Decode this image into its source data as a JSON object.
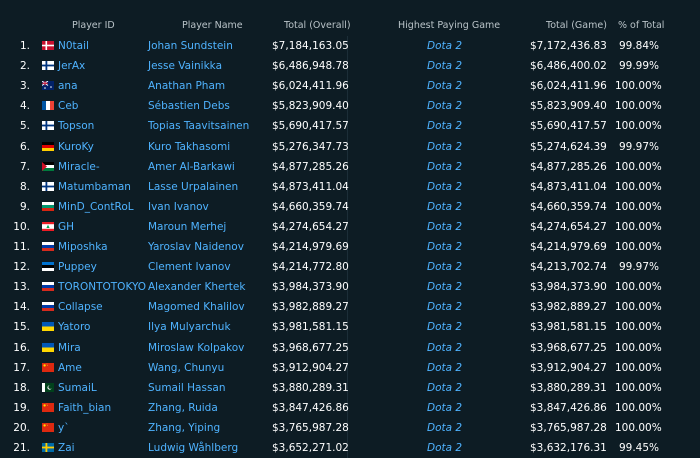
{
  "headers": {
    "player_id": "Player ID",
    "player_name": "Player Name",
    "total_overall": "Total (Overall)",
    "highest_game": "Highest Paying Game",
    "total_game": "Total (Game)",
    "pct_total": "% of Total"
  },
  "rows": [
    {
      "rank": "1.",
      "flag": "dk",
      "id": "N0tail",
      "name": "Johan Sundstein",
      "total": "$7,184,163.05",
      "game": "Dota 2",
      "game_total": "$7,172,436.83",
      "pct": "99.84%"
    },
    {
      "rank": "2.",
      "flag": "fi",
      "id": "JerAx",
      "name": "Jesse Vainikka",
      "total": "$6,486,948.78",
      "game": "Dota 2",
      "game_total": "$6,486,400.02",
      "pct": "99.99%"
    },
    {
      "rank": "3.",
      "flag": "au",
      "id": "ana",
      "name": "Anathan Pham",
      "total": "$6,024,411.96",
      "game": "Dota 2",
      "game_total": "$6,024,411.96",
      "pct": "100.00%"
    },
    {
      "rank": "4.",
      "flag": "fr",
      "id": "Ceb",
      "name": "Sébastien Debs",
      "total": "$5,823,909.40",
      "game": "Dota 2",
      "game_total": "$5,823,909.40",
      "pct": "100.00%"
    },
    {
      "rank": "5.",
      "flag": "fi",
      "id": "Topson",
      "name": "Topias Taavitsainen",
      "total": "$5,690,417.57",
      "game": "Dota 2",
      "game_total": "$5,690,417.57",
      "pct": "100.00%"
    },
    {
      "rank": "6.",
      "flag": "de",
      "id": "KuroKy",
      "name": "Kuro Takhasomi",
      "total": "$5,276,347.73",
      "game": "Dota 2",
      "game_total": "$5,274,624.39",
      "pct": "99.97%"
    },
    {
      "rank": "7.",
      "flag": "jo",
      "id": "Miracle-",
      "name": "Amer Al-Barkawi",
      "total": "$4,877,285.26",
      "game": "Dota 2",
      "game_total": "$4,877,285.26",
      "pct": "100.00%"
    },
    {
      "rank": "8.",
      "flag": "fi",
      "id": "Matumbaman",
      "name": "Lasse Urpalainen",
      "total": "$4,873,411.04",
      "game": "Dota 2",
      "game_total": "$4,873,411.04",
      "pct": "100.00%"
    },
    {
      "rank": "9.",
      "flag": "bg",
      "id": "MinD_ContRoL",
      "name": "Ivan Ivanov",
      "total": "$4,660,359.74",
      "game": "Dota 2",
      "game_total": "$4,660,359.74",
      "pct": "100.00%"
    },
    {
      "rank": "10.",
      "flag": "lb",
      "id": "GH",
      "name": "Maroun Merhej",
      "total": "$4,274,654.27",
      "game": "Dota 2",
      "game_total": "$4,274,654.27",
      "pct": "100.00%"
    },
    {
      "rank": "11.",
      "flag": "ru",
      "id": "Miposhka",
      "name": "Yaroslav Naidenov",
      "total": "$4,214,979.69",
      "game": "Dota 2",
      "game_total": "$4,214,979.69",
      "pct": "100.00%"
    },
    {
      "rank": "12.",
      "flag": "ee",
      "id": "Puppey",
      "name": "Clement Ivanov",
      "total": "$4,214,772.80",
      "game": "Dota 2",
      "game_total": "$4,213,702.74",
      "pct": "99.97%"
    },
    {
      "rank": "13.",
      "flag": "ru",
      "id": "TORONTOTOKYO",
      "name": "Alexander Khertek",
      "total": "$3,984,373.90",
      "game": "Dota 2",
      "game_total": "$3,984,373.90",
      "pct": "100.00%"
    },
    {
      "rank": "14.",
      "flag": "ru",
      "id": "Collapse",
      "name": "Magomed Khalilov",
      "total": "$3,982,889.27",
      "game": "Dota 2",
      "game_total": "$3,982,889.27",
      "pct": "100.00%"
    },
    {
      "rank": "15.",
      "flag": "ua",
      "id": "Yatoro",
      "name": "Ilya Mulyarchuk",
      "total": "$3,981,581.15",
      "game": "Dota 2",
      "game_total": "$3,981,581.15",
      "pct": "100.00%"
    },
    {
      "rank": "16.",
      "flag": "ua",
      "id": "Mira",
      "name": "Miroslaw Kolpakov",
      "total": "$3,968,677.25",
      "game": "Dota 2",
      "game_total": "$3,968,677.25",
      "pct": "100.00%"
    },
    {
      "rank": "17.",
      "flag": "cn",
      "id": "Ame",
      "name": "Wang, Chunyu",
      "total": "$3,912,904.27",
      "game": "Dota 2",
      "game_total": "$3,912,904.27",
      "pct": "100.00%"
    },
    {
      "rank": "18.",
      "flag": "pk",
      "id": "SumaiL",
      "name": "Sumail Hassan",
      "total": "$3,880,289.31",
      "game": "Dota 2",
      "game_total": "$3,880,289.31",
      "pct": "100.00%"
    },
    {
      "rank": "19.",
      "flag": "cn",
      "id": "Faith_bian",
      "name": "Zhang, Ruida",
      "total": "$3,847,426.86",
      "game": "Dota 2",
      "game_total": "$3,847,426.86",
      "pct": "100.00%"
    },
    {
      "rank": "20.",
      "flag": "cn",
      "id": "y`",
      "name": "Zhang, Yiping",
      "total": "$3,765,987.28",
      "game": "Dota 2",
      "game_total": "$3,765,987.28",
      "pct": "100.00%"
    },
    {
      "rank": "21.",
      "flag": "se",
      "id": "Zai",
      "name": "Ludwig Wåhlberg",
      "total": "$3,652,271.02",
      "game": "Dota 2",
      "game_total": "$3,632,176.31",
      "pct": "99.45%"
    }
  ]
}
